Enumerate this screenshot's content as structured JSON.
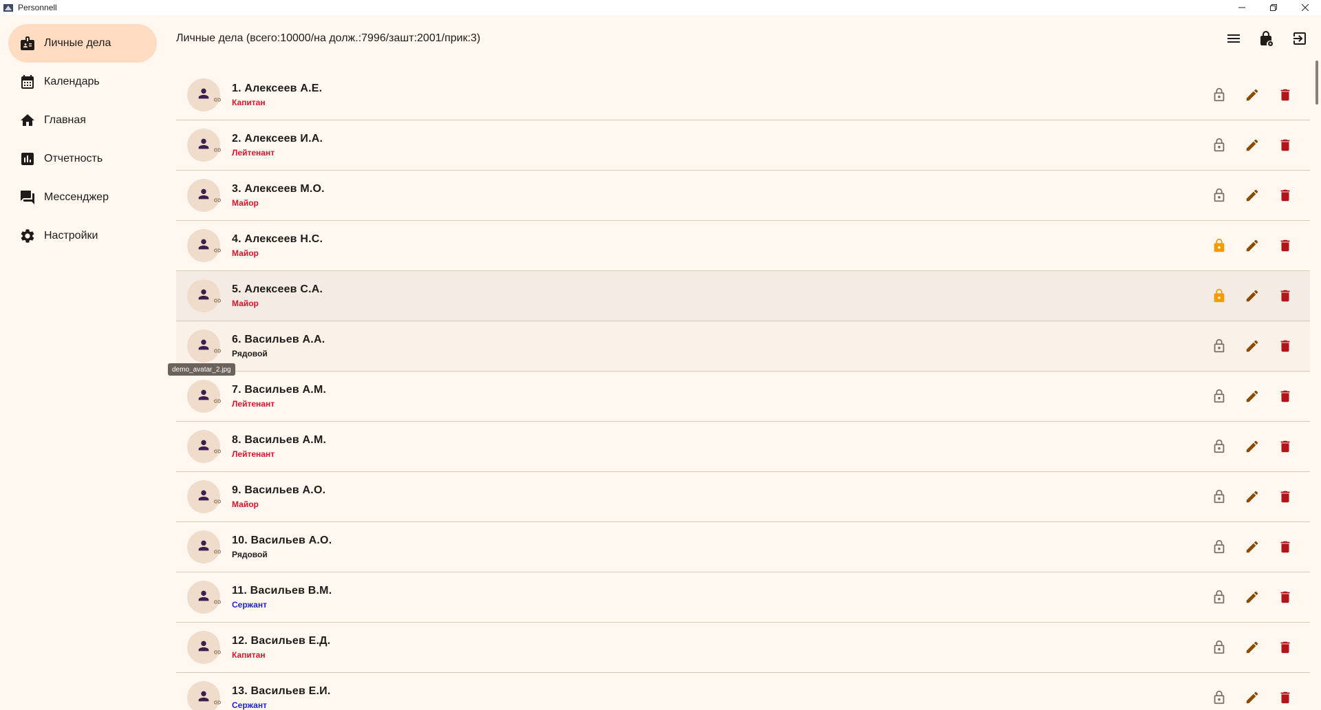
{
  "window": {
    "title": "Personnell"
  },
  "sidebar": {
    "items": [
      {
        "label": "Личные дела",
        "icon": "badge-icon",
        "active": true
      },
      {
        "label": "Календарь",
        "icon": "calendar-icon",
        "active": false
      },
      {
        "label": "Главная",
        "icon": "home-icon",
        "active": false
      },
      {
        "label": "Отчетность",
        "icon": "bar-chart-icon",
        "active": false
      },
      {
        "label": "Мессенджер",
        "icon": "chat-icon",
        "active": false
      },
      {
        "label": "Настройки",
        "icon": "settings-icon",
        "active": false
      }
    ]
  },
  "header": {
    "title": "Личные дела (всего:10000/на долж.:7996/зашт:2001/прик:3)"
  },
  "colors": {
    "rank_red": "#e0132a",
    "rank_blue": "#1f22d6",
    "rank_black": "#1e1b18",
    "lock_orange": "#f59b00",
    "lock_open": "#7a6e66",
    "edit": "#8b4a00",
    "delete": "#b3141a"
  },
  "tooltip": {
    "text": "demo_avatar_2.jpg"
  },
  "rows": [
    {
      "name": "1. Алексеев А.Е.",
      "rank": "Капитан",
      "rank_color": "#e0132a",
      "locked": false
    },
    {
      "name": "2. Алексеев И.А.",
      "rank": "Лейтенант",
      "rank_color": "#e0132a",
      "locked": false
    },
    {
      "name": "3. Алексеев М.О.",
      "rank": "Майор",
      "rank_color": "#e0132a",
      "locked": false
    },
    {
      "name": "4. Алексеев Н.С.",
      "rank": "Майор",
      "rank_color": "#e0132a",
      "locked": true
    },
    {
      "name": "5. Алексеев С.А.",
      "rank": "Майор",
      "rank_color": "#e0132a",
      "locked": true
    },
    {
      "name": "6. Васильев А.А.",
      "rank": "Рядовой",
      "rank_color": "#1e1b18",
      "locked": false
    },
    {
      "name": "7. Васильев А.М.",
      "rank": "Лейтенант",
      "rank_color": "#e0132a",
      "locked": false
    },
    {
      "name": "8. Васильев А.М.",
      "rank": "Лейтенант",
      "rank_color": "#e0132a",
      "locked": false
    },
    {
      "name": "9. Васильев А.О.",
      "rank": "Майор",
      "rank_color": "#e0132a",
      "locked": false
    },
    {
      "name": "10. Васильев А.О.",
      "rank": "Рядовой",
      "rank_color": "#1e1b18",
      "locked": false
    },
    {
      "name": "11. Васильев В.М.",
      "rank": "Сержант",
      "rank_color": "#1f22d6",
      "locked": false
    },
    {
      "name": "12. Васильев Е.Д.",
      "rank": "Капитан",
      "rank_color": "#e0132a",
      "locked": false
    },
    {
      "name": "13. Васильев Е.И.",
      "rank": "Сержант",
      "rank_color": "#1f22d6",
      "locked": false
    }
  ]
}
